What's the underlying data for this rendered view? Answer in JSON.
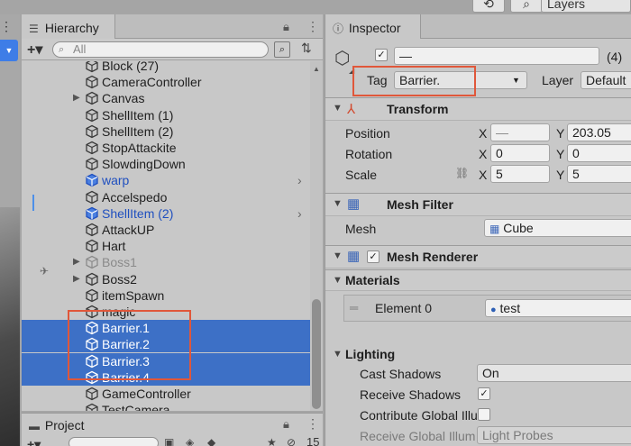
{
  "top": {
    "history_icon": "history-icon",
    "search_icon": "search-icon",
    "layers_label": "Layers"
  },
  "hierarchy": {
    "title": "Hierarchy",
    "lock_icon": "lock-icon",
    "menu_icon": "kebab-icon",
    "add_label": "+▾",
    "search_placeholder": "All",
    "items": [
      {
        "label": "Block (27)",
        "state": "normal",
        "has_arrow": false
      },
      {
        "label": "CameraController",
        "state": "normal",
        "has_arrow": false
      },
      {
        "label": "Canvas",
        "state": "normal",
        "has_arrow": true
      },
      {
        "label": "ShellItem (1)",
        "state": "normal",
        "has_arrow": false
      },
      {
        "label": "ShellItem (2)",
        "state": "normal",
        "has_arrow": false
      },
      {
        "label": "StopAttackite",
        "state": "normal",
        "has_arrow": false
      },
      {
        "label": "SlowdingDown",
        "state": "normal",
        "has_arrow": false
      },
      {
        "label": "warp",
        "state": "prefab",
        "has_arrow": false
      },
      {
        "label": "Accelspedo",
        "state": "normal",
        "has_arrow": false
      },
      {
        "label": "ShellItem (2)",
        "state": "prefab",
        "has_arrow": false
      },
      {
        "label": "AttackUP",
        "state": "normal",
        "has_arrow": false
      },
      {
        "label": "Hart",
        "state": "normal",
        "has_arrow": false
      },
      {
        "label": "Boss1",
        "state": "disabled",
        "has_arrow": true
      },
      {
        "label": "Boss2",
        "state": "normal",
        "has_arrow": true
      },
      {
        "label": "itemSpawn",
        "state": "normal",
        "has_arrow": false
      },
      {
        "label": "magic",
        "state": "normal",
        "has_arrow": false
      },
      {
        "label": "Barrier.1",
        "state": "selected",
        "has_arrow": false
      },
      {
        "label": "Barrier.2",
        "state": "selected",
        "has_arrow": false
      },
      {
        "label": "Barrier.3",
        "state": "selected",
        "has_arrow": false
      },
      {
        "label": "Barrier.4",
        "state": "selected",
        "has_arrow": false
      },
      {
        "label": "GameController",
        "state": "normal",
        "has_arrow": false
      },
      {
        "label": "TestCamera",
        "state": "normal",
        "has_arrow": false
      }
    ]
  },
  "project": {
    "title": "Project",
    "count": "15"
  },
  "inspector": {
    "title": "Inspector",
    "object_name": "—",
    "multi_count": "(4)",
    "tag_label": "Tag",
    "tag_value": "Barrier.",
    "layer_label": "Layer",
    "layer_value": "Default",
    "transform": {
      "title": "Transform",
      "position_label": "Position",
      "rotation_label": "Rotation",
      "scale_label": "Scale",
      "x_label": "X",
      "y_label": "Y",
      "position_x": "—",
      "position_y": "203.05",
      "rotation_x": "0",
      "rotation_y": "0",
      "scale_x": "5",
      "scale_y": "5"
    },
    "mesh_filter": {
      "title": "Mesh Filter",
      "mesh_label": "Mesh",
      "mesh_value": "Cube"
    },
    "mesh_renderer": {
      "title": "Mesh Renderer",
      "materials_label": "Materials",
      "element_label": "Element 0",
      "element_value": "test",
      "lighting_label": "Lighting",
      "cast_shadows_label": "Cast Shadows",
      "cast_shadows_value": "On",
      "receive_shadows_label": "Receive Shadows",
      "contribute_gi_label": "Contribute Global Illu",
      "receive_gi_label": "Receive Global Illum",
      "receive_gi_value": "Light Probes"
    }
  },
  "colors": {
    "selection": "#3d70c6",
    "highlight_box": "#e0573a",
    "prefab_text": "#1f4fbf",
    "panel_bg": "#c8c8c8"
  }
}
